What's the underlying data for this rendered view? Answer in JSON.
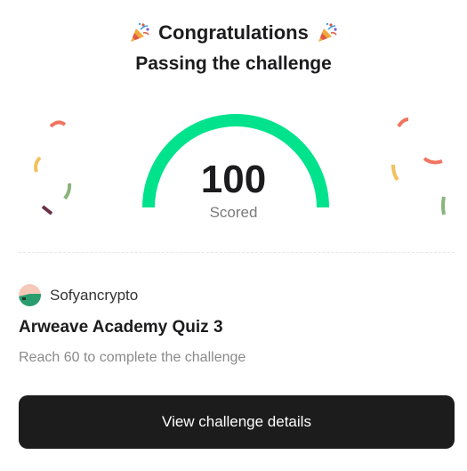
{
  "header": {
    "title": "Congratulations",
    "subtitle": "Passing the challenge",
    "left_icon": "party-popper-icon",
    "right_icon": "party-popper-icon"
  },
  "score": {
    "value": "100",
    "label": "Scored",
    "fraction": 1.0,
    "gauge_color": "#00e38c"
  },
  "challenge": {
    "author": "Sofyancrypto",
    "title": "Arweave Academy Quiz 3",
    "description": "Reach 60 to complete the challenge"
  },
  "cta": {
    "label": "View challenge details"
  },
  "colors": {
    "confetti_red": "#f07560",
    "confetti_yellow": "#f2c05e",
    "confetti_green": "#8ab47c",
    "confetti_purple": "#6b3048",
    "button_bg": "#1c1c1c"
  }
}
